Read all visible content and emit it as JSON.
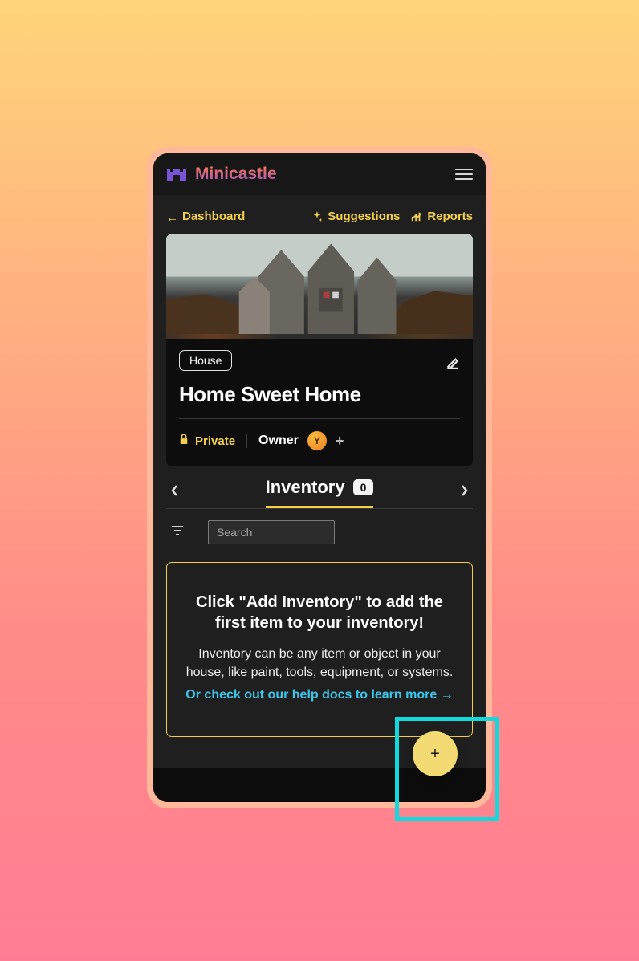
{
  "brand": {
    "name": "Minicastle"
  },
  "nav": {
    "back_label": "Dashboard",
    "suggestions_label": "Suggestions",
    "reports_label": "Reports"
  },
  "home": {
    "tag": "House",
    "title": "Home Sweet Home",
    "privacy_label": "Private",
    "owner_label": "Owner",
    "owner_initial": "Y"
  },
  "tab": {
    "title": "Inventory",
    "count": "0"
  },
  "search": {
    "placeholder": "Search"
  },
  "empty": {
    "heading": "Click \"Add Inventory\" to add the first item to your inventory!",
    "body": "Inventory can be any item or object in your house, like paint, tools, equipment, or systems.",
    "link": "Or check out our help docs to learn more →"
  },
  "fab": {
    "glyph": "+"
  }
}
